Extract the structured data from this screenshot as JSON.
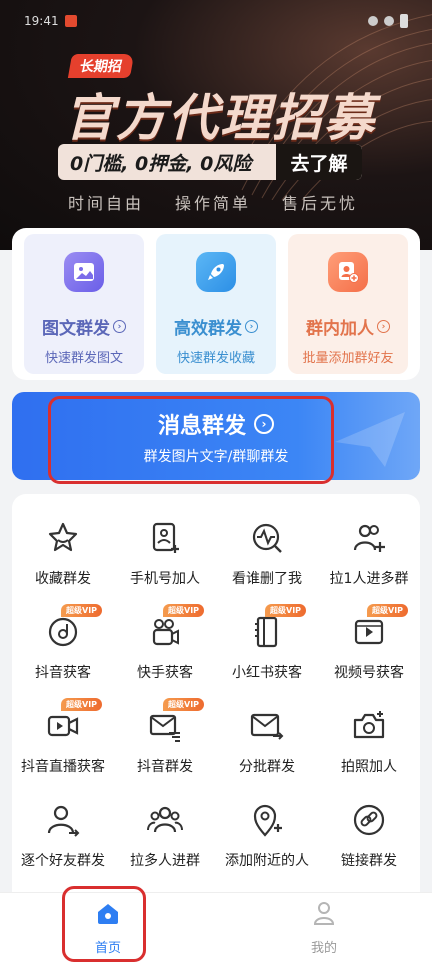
{
  "statusbar": {
    "time": "19:41"
  },
  "banner": {
    "tag": "长期招",
    "headline": "官方代理招募",
    "offer_text": "0门槛, 0押金, 0风险",
    "offer_cta": "去了解",
    "features": [
      "时间自由",
      "操作简单",
      "售后无忧"
    ]
  },
  "cards": [
    {
      "title": "图文群发",
      "subtitle": "快速群发图文",
      "icon": "image-icon"
    },
    {
      "title": "高效群发",
      "subtitle": "快速群发收藏",
      "icon": "rocket-icon"
    },
    {
      "title": "群内加人",
      "subtitle": "批量添加群好友",
      "icon": "add-user-icon"
    }
  ],
  "mass_send": {
    "title": "消息群发",
    "subtitle": "群发图片文字/群聊群发"
  },
  "vip_badge": "超级VIP",
  "grid": [
    {
      "label": "收藏群发",
      "icon": "star-icon",
      "vip": false
    },
    {
      "label": "手机号加人",
      "icon": "phone-card-icon",
      "vip": false
    },
    {
      "label": "看谁删了我",
      "icon": "pulse-search-icon",
      "vip": false
    },
    {
      "label": "拉1人进多群",
      "icon": "group-add-icon",
      "vip": false
    },
    {
      "label": "抖音获客",
      "icon": "douyin-icon",
      "vip": true
    },
    {
      "label": "快手获客",
      "icon": "kuaishou-icon",
      "vip": true
    },
    {
      "label": "小红书获客",
      "icon": "notebook-icon",
      "vip": true
    },
    {
      "label": "视频号获客",
      "icon": "video-channel-icon",
      "vip": true
    },
    {
      "label": "抖音直播获客",
      "icon": "live-camera-icon",
      "vip": true
    },
    {
      "label": "抖音群发",
      "icon": "mail-send-icon",
      "vip": true
    },
    {
      "label": "分批群发",
      "icon": "mail-batch-icon",
      "vip": false
    },
    {
      "label": "拍照加人",
      "icon": "camera-add-icon",
      "vip": false
    },
    {
      "label": "逐个好友群发",
      "icon": "person-send-icon",
      "vip": false
    },
    {
      "label": "拉多人进群",
      "icon": "people-icon",
      "vip": false
    },
    {
      "label": "添加附近的人",
      "icon": "location-add-icon",
      "vip": false
    },
    {
      "label": "链接群发",
      "icon": "link-icon",
      "vip": false
    }
  ],
  "tabs": [
    {
      "label": "首页",
      "active": true
    },
    {
      "label": "我的",
      "active": false
    }
  ],
  "colors": {
    "primary": "#2f6ff0",
    "highlight": "#d92f2f",
    "vip": "#ee6b2f"
  }
}
